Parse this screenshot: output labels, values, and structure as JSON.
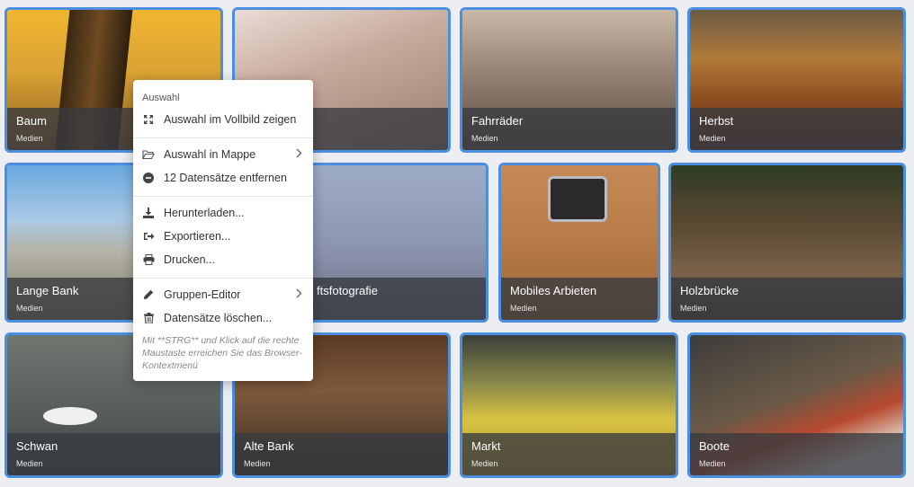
{
  "tiles": [
    {
      "title": "Baum",
      "sub": "Medien"
    },
    {
      "title": "",
      "sub": ""
    },
    {
      "title": "Fahrräder",
      "sub": "Medien"
    },
    {
      "title": "Herbst",
      "sub": "Medien"
    },
    {
      "title": "Lange Bank",
      "sub": "Medien"
    },
    {
      "title": "ftsfotografie",
      "sub": ""
    },
    {
      "title": "Mobiles Arbieten",
      "sub": "Medien"
    },
    {
      "title": "Holzbrücke",
      "sub": "Medien"
    },
    {
      "title": "Schwan",
      "sub": "Medien"
    },
    {
      "title": "Alte Bank",
      "sub": "Medien"
    },
    {
      "title": "Markt",
      "sub": "Medien"
    },
    {
      "title": "Boote",
      "sub": "Medien"
    }
  ],
  "menu": {
    "header": "Auswahl",
    "items": [
      {
        "label": "Auswahl im Vollbild zeigen",
        "icon": "fullscreen-icon"
      },
      {
        "label": "Auswahl in Mappe",
        "icon": "folder-open-icon"
      },
      {
        "label": "12 Datensätze entfernen",
        "icon": "minus-circle-icon"
      },
      {
        "label": "Herunterladen...",
        "icon": "download-icon"
      },
      {
        "label": "Exportieren...",
        "icon": "export-icon"
      },
      {
        "label": "Drucken...",
        "icon": "print-icon"
      },
      {
        "label": "Gruppen-Editor",
        "icon": "edit-icon"
      },
      {
        "label": "Datensätze löschen...",
        "icon": "trash-icon"
      }
    ],
    "hint": "Mit **STRG** und Klick auf die rechte Maustaste erreichen Sie das Browser-Kontextmenü"
  },
  "colors": {
    "selection_border": "#4a8fe2",
    "caption_bg": "#373a40"
  }
}
